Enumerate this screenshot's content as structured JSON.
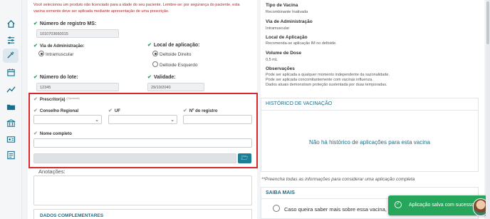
{
  "sidebar": {
    "icons": [
      "home-icon",
      "sliders-icon",
      "vaccine-icon",
      "calendar-icon",
      "chart-icon",
      "folder-icon",
      "building-icon",
      "badge-icon",
      "report-icon"
    ]
  },
  "form": {
    "warning": "Você selecionou um produto não licenciado para a idade do seu paciente. Lembre-se: por segurança do paciente, esta vacina somente deve ser aplicada mediante apresentação de uma prescrição.",
    "registro_label": "Número de registro MS:",
    "registro_value": "1010703660015",
    "via_label": "Via de Administração:",
    "via_option": "Intramuscular",
    "local_label": "Local de aplicação:",
    "local_option1": "Deltoide Direito",
    "local_option2": "Deltoide Esquerdo",
    "lote_label": "Número do lote:",
    "lote_value": "12345",
    "validade_label": "Validade:",
    "validade_value": "29/10/2040",
    "prescritor_label": "Prescritor(a)",
    "prescritor_tag": "(Opcional)",
    "conselho_label": "Conselho Regional",
    "uf_label": "UF",
    "nregistro_label": "Nº do registro",
    "nome_label": "Nome completo",
    "anotacoes_label": "Anotações:",
    "dados_label": "DADOS COMPLEMENTARES"
  },
  "info": {
    "tipo_h": "Tipo de Vacina",
    "tipo_v": "Recombinante Inativada",
    "via_h": "Via de Administração",
    "via_v": "Intramuscular",
    "local_h": "Local de Aplicação",
    "local_v": "Recomenda-se aplicação IM no deltoide.",
    "dose_h": "Volume de Dose",
    "dose_v": "0,5 mL",
    "obs_h": "Observações",
    "obs_v1": "Pode ser aplicada a qualquer momento independente da sazonalidade.",
    "obs_v2": "Pode ser aplicada concomitantemente com vacinas influenza.",
    "obs_v3": "Dados atuais demonstram proteção sustentada por duas temporadas."
  },
  "historico": {
    "title": "HISTÓRICO DE VACINAÇÃO",
    "empty": "Não há histórico de aplicações para esta vacina"
  },
  "note": "**Preencha todas as informações para considerar uma aplicação completa",
  "saiba": {
    "title": "SAIBA MAIS",
    "text": "Caso queira saber mais sobre essa vacina, acesse"
  },
  "toast": {
    "message": "Aplicação salva com sucesso"
  },
  "colors": {
    "accent": "#1b7e96",
    "warning": "#b02a2a",
    "success": "#26a65b",
    "highlight": "#d8282b"
  }
}
